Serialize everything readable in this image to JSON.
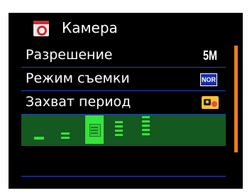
{
  "header": {
    "title": "Камера",
    "icon": "camera-icon"
  },
  "menu": {
    "items": [
      {
        "label": "Разрешение",
        "value": "5M"
      },
      {
        "label": "Режим съемки",
        "value": "NOR",
        "icon": "normal-mode-icon"
      },
      {
        "label": "Захват период",
        "icon": "timelapse-camera-icon"
      }
    ],
    "levels": {
      "count": 5,
      "selected_index": 2
    }
  },
  "colors": {
    "background": "#000000",
    "divider": "#1f43c8",
    "selected_row": "#14591f",
    "level_green": "#36e33a",
    "scrollbar": "#f07a1a"
  }
}
